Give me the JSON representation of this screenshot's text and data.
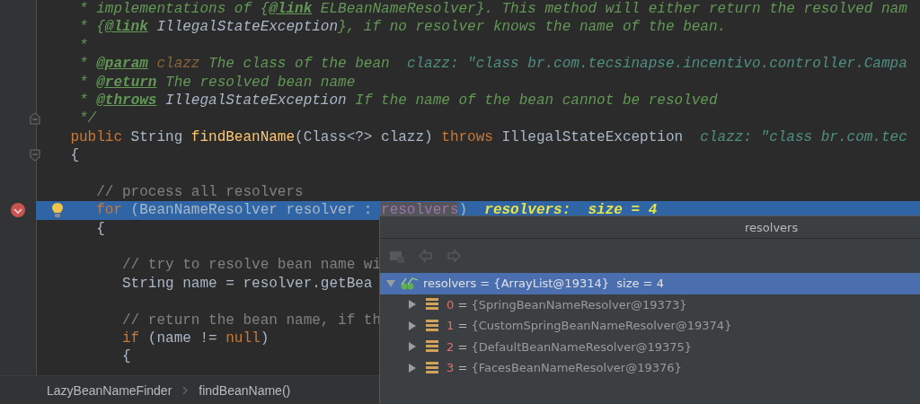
{
  "editor": {
    "lines": [
      {
        "selected": false,
        "breakpoint": false,
        "bulb": false,
        "tokens": [
          {
            "text": "     * implementations of {",
            "kind": "comment"
          },
          {
            "text": "@link",
            "kind": "doctag"
          },
          {
            "text": " ELBeanNameResolver}. This method will either return the resolved nam",
            "kind": "comment"
          }
        ]
      },
      {
        "selected": false,
        "breakpoint": false,
        "bulb": false,
        "tokens": [
          {
            "text": "     * {",
            "kind": "comment"
          },
          {
            "text": "@link",
            "kind": "doctag"
          },
          {
            "text": " IllegalStateException",
            "kind": "docref"
          },
          {
            "text": "}, if no resolver knows the name of the bean.",
            "kind": "comment"
          }
        ]
      },
      {
        "selected": false,
        "breakpoint": false,
        "bulb": false,
        "tokens": [
          {
            "text": "     *",
            "kind": "comment"
          }
        ]
      },
      {
        "selected": false,
        "breakpoint": false,
        "bulb": false,
        "tokens": [
          {
            "text": "     * ",
            "kind": "comment"
          },
          {
            "text": "@param",
            "kind": "doctag"
          },
          {
            "text": " clazz",
            "kind": "param"
          },
          {
            "text": " The class of the bean",
            "kind": "comment"
          },
          {
            "text": "  clazz: \"class br.com.tecsinapse.incentivo.controller.Campa",
            "kind": "inline"
          }
        ]
      },
      {
        "selected": false,
        "breakpoint": false,
        "bulb": false,
        "tokens": [
          {
            "text": "     * ",
            "kind": "comment"
          },
          {
            "text": "@return",
            "kind": "doctag"
          },
          {
            "text": " The resolved bean name",
            "kind": "comment"
          }
        ]
      },
      {
        "selected": false,
        "breakpoint": false,
        "bulb": false,
        "tokens": [
          {
            "text": "     * ",
            "kind": "comment"
          },
          {
            "text": "@throws",
            "kind": "doctag"
          },
          {
            "text": " IllegalStateException",
            "kind": "docref"
          },
          {
            "text": " If the name of the bean cannot be resolved",
            "kind": "comment"
          }
        ]
      },
      {
        "selected": false,
        "breakpoint": false,
        "bulb": false,
        "fold": {
          "kind": "end"
        },
        "tokens": [
          {
            "text": "     */",
            "kind": "comment"
          }
        ]
      },
      {
        "selected": false,
        "breakpoint": false,
        "bulb": false,
        "tokens": [
          {
            "text": "    public",
            "kind": "keyword"
          },
          {
            "text": " String ",
            "kind": "plain"
          },
          {
            "text": "findBeanName",
            "kind": "method"
          },
          {
            "text": "(Class<?> clazz) ",
            "kind": "plain"
          },
          {
            "text": "throws",
            "kind": "keyword"
          },
          {
            "text": " IllegalStateException",
            "kind": "plain"
          },
          {
            "text": "  clazz: \"class br.com.tec",
            "kind": "inline"
          }
        ]
      },
      {
        "selected": false,
        "breakpoint": false,
        "bulb": false,
        "fold": {
          "kind": "start"
        },
        "tokens": [
          {
            "text": "    {",
            "kind": "plain"
          }
        ]
      },
      {
        "selected": false,
        "breakpoint": false,
        "bulb": false
      },
      {
        "selected": false,
        "breakpoint": false,
        "bulb": false,
        "tokens": [
          {
            "text": "       // process all resolvers",
            "kind": "linecomment"
          }
        ]
      },
      {
        "selected": true,
        "breakpoint": true,
        "bulb": true,
        "tokens": [
          {
            "text": "       for",
            "kind": "keyword"
          },
          {
            "text": " (BeanNameResolver resolver : ",
            "kind": "plain"
          },
          {
            "text": "resolvers",
            "kind": "usage"
          },
          {
            "text": ")",
            "kind": "plain"
          },
          {
            "text": "  resolvers:  size = 4",
            "kind": "inlinebold"
          }
        ]
      },
      {
        "selected": false,
        "breakpoint": false,
        "bulb": false,
        "tokens": [
          {
            "text": "       {",
            "kind": "plain"
          }
        ]
      },
      {
        "selected": false,
        "breakpoint": false,
        "bulb": false
      },
      {
        "selected": false,
        "breakpoint": false,
        "bulb": false,
        "tokens": [
          {
            "text": "          // try to resolve bean name wi",
            "kind": "linecomment"
          }
        ]
      },
      {
        "selected": false,
        "breakpoint": false,
        "bulb": false,
        "tokens": [
          {
            "text": "          String name = resolver.getBea",
            "kind": "plain"
          }
        ]
      },
      {
        "selected": false,
        "breakpoint": false,
        "bulb": false
      },
      {
        "selected": false,
        "breakpoint": false,
        "bulb": false,
        "tokens": [
          {
            "text": "          // return the bean name, if th",
            "kind": "linecomment"
          }
        ]
      },
      {
        "selected": false,
        "breakpoint": false,
        "bulb": false,
        "tokens": [
          {
            "text": "          if",
            "kind": "keyword"
          },
          {
            "text": " (name != ",
            "kind": "plain"
          },
          {
            "text": "null",
            "kind": "keyword"
          },
          {
            "text": ")",
            "kind": "plain"
          }
        ]
      },
      {
        "selected": false,
        "breakpoint": false,
        "bulb": false,
        "tokens": [
          {
            "text": "          {",
            "kind": "plain"
          }
        ]
      }
    ]
  },
  "breadcrumbs": [
    {
      "label": "LazyBeanNameFinder"
    },
    {
      "label": "findBeanName()"
    }
  ],
  "popup": {
    "title": "resolvers",
    "toolbar": [
      {
        "kind": "folder",
        "disabled": true
      },
      {
        "kind": "back",
        "disabled": true
      },
      {
        "kind": "forward",
        "disabled": true
      }
    ],
    "tree": {
      "label": "resolvers = {ArrayList@19314}  size = 4",
      "expanded": true,
      "selected": true,
      "children": [
        {
          "index": "0",
          "op": "=",
          "value": "{SpringBeanNameResolver@19373}",
          "expanded": false,
          "selected": false
        },
        {
          "index": "1",
          "op": "=",
          "value": "{CustomSpringBeanNameResolver@19374}",
          "expanded": false,
          "selected": false
        },
        {
          "index": "2",
          "op": "=",
          "value": "{DefaultBeanNameResolver@19375}",
          "expanded": false,
          "selected": false
        },
        {
          "index": "3",
          "op": "=",
          "value": "{FacesBeanNameResolver@19376}",
          "expanded": false,
          "selected": false
        }
      ]
    }
  }
}
